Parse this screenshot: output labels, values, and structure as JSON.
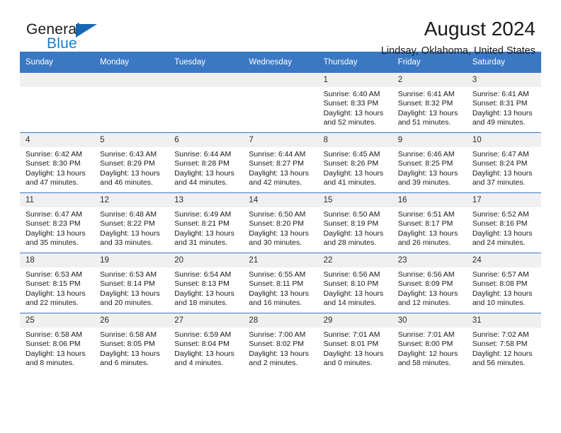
{
  "brand": {
    "name_top": "General",
    "name_bottom": "Blue",
    "accent_color": "#1a7ec8",
    "triangle_color": "#1567b2"
  },
  "header": {
    "month_title": "August 2024",
    "location": "Lindsay, Oklahoma, United States"
  },
  "calendar": {
    "header_color": "#3b78c3",
    "daynum_background": "#f0f0f0",
    "weekdays": [
      "Sunday",
      "Monday",
      "Tuesday",
      "Wednesday",
      "Thursday",
      "Friday",
      "Saturday"
    ],
    "weeks": [
      [
        {
          "day": "",
          "empty": true
        },
        {
          "day": "",
          "empty": true
        },
        {
          "day": "",
          "empty": true
        },
        {
          "day": "",
          "empty": true
        },
        {
          "day": "1",
          "sunrise": "Sunrise: 6:40 AM",
          "sunset": "Sunset: 8:33 PM",
          "daylight_line1": "Daylight: 13 hours",
          "daylight_line2": "and 52 minutes."
        },
        {
          "day": "2",
          "sunrise": "Sunrise: 6:41 AM",
          "sunset": "Sunset: 8:32 PM",
          "daylight_line1": "Daylight: 13 hours",
          "daylight_line2": "and 51 minutes."
        },
        {
          "day": "3",
          "sunrise": "Sunrise: 6:41 AM",
          "sunset": "Sunset: 8:31 PM",
          "daylight_line1": "Daylight: 13 hours",
          "daylight_line2": "and 49 minutes."
        }
      ],
      [
        {
          "day": "4",
          "sunrise": "Sunrise: 6:42 AM",
          "sunset": "Sunset: 8:30 PM",
          "daylight_line1": "Daylight: 13 hours",
          "daylight_line2": "and 47 minutes."
        },
        {
          "day": "5",
          "sunrise": "Sunrise: 6:43 AM",
          "sunset": "Sunset: 8:29 PM",
          "daylight_line1": "Daylight: 13 hours",
          "daylight_line2": "and 46 minutes."
        },
        {
          "day": "6",
          "sunrise": "Sunrise: 6:44 AM",
          "sunset": "Sunset: 8:28 PM",
          "daylight_line1": "Daylight: 13 hours",
          "daylight_line2": "and 44 minutes."
        },
        {
          "day": "7",
          "sunrise": "Sunrise: 6:44 AM",
          "sunset": "Sunset: 8:27 PM",
          "daylight_line1": "Daylight: 13 hours",
          "daylight_line2": "and 42 minutes."
        },
        {
          "day": "8",
          "sunrise": "Sunrise: 6:45 AM",
          "sunset": "Sunset: 8:26 PM",
          "daylight_line1": "Daylight: 13 hours",
          "daylight_line2": "and 41 minutes."
        },
        {
          "day": "9",
          "sunrise": "Sunrise: 6:46 AM",
          "sunset": "Sunset: 8:25 PM",
          "daylight_line1": "Daylight: 13 hours",
          "daylight_line2": "and 39 minutes."
        },
        {
          "day": "10",
          "sunrise": "Sunrise: 6:47 AM",
          "sunset": "Sunset: 8:24 PM",
          "daylight_line1": "Daylight: 13 hours",
          "daylight_line2": "and 37 minutes."
        }
      ],
      [
        {
          "day": "11",
          "sunrise": "Sunrise: 6:47 AM",
          "sunset": "Sunset: 8:23 PM",
          "daylight_line1": "Daylight: 13 hours",
          "daylight_line2": "and 35 minutes."
        },
        {
          "day": "12",
          "sunrise": "Sunrise: 6:48 AM",
          "sunset": "Sunset: 8:22 PM",
          "daylight_line1": "Daylight: 13 hours",
          "daylight_line2": "and 33 minutes."
        },
        {
          "day": "13",
          "sunrise": "Sunrise: 6:49 AM",
          "sunset": "Sunset: 8:21 PM",
          "daylight_line1": "Daylight: 13 hours",
          "daylight_line2": "and 31 minutes."
        },
        {
          "day": "14",
          "sunrise": "Sunrise: 6:50 AM",
          "sunset": "Sunset: 8:20 PM",
          "daylight_line1": "Daylight: 13 hours",
          "daylight_line2": "and 30 minutes."
        },
        {
          "day": "15",
          "sunrise": "Sunrise: 6:50 AM",
          "sunset": "Sunset: 8:19 PM",
          "daylight_line1": "Daylight: 13 hours",
          "daylight_line2": "and 28 minutes."
        },
        {
          "day": "16",
          "sunrise": "Sunrise: 6:51 AM",
          "sunset": "Sunset: 8:17 PM",
          "daylight_line1": "Daylight: 13 hours",
          "daylight_line2": "and 26 minutes."
        },
        {
          "day": "17",
          "sunrise": "Sunrise: 6:52 AM",
          "sunset": "Sunset: 8:16 PM",
          "daylight_line1": "Daylight: 13 hours",
          "daylight_line2": "and 24 minutes."
        }
      ],
      [
        {
          "day": "18",
          "sunrise": "Sunrise: 6:53 AM",
          "sunset": "Sunset: 8:15 PM",
          "daylight_line1": "Daylight: 13 hours",
          "daylight_line2": "and 22 minutes."
        },
        {
          "day": "19",
          "sunrise": "Sunrise: 6:53 AM",
          "sunset": "Sunset: 8:14 PM",
          "daylight_line1": "Daylight: 13 hours",
          "daylight_line2": "and 20 minutes."
        },
        {
          "day": "20",
          "sunrise": "Sunrise: 6:54 AM",
          "sunset": "Sunset: 8:13 PM",
          "daylight_line1": "Daylight: 13 hours",
          "daylight_line2": "and 18 minutes."
        },
        {
          "day": "21",
          "sunrise": "Sunrise: 6:55 AM",
          "sunset": "Sunset: 8:11 PM",
          "daylight_line1": "Daylight: 13 hours",
          "daylight_line2": "and 16 minutes."
        },
        {
          "day": "22",
          "sunrise": "Sunrise: 6:56 AM",
          "sunset": "Sunset: 8:10 PM",
          "daylight_line1": "Daylight: 13 hours",
          "daylight_line2": "and 14 minutes."
        },
        {
          "day": "23",
          "sunrise": "Sunrise: 6:56 AM",
          "sunset": "Sunset: 8:09 PM",
          "daylight_line1": "Daylight: 13 hours",
          "daylight_line2": "and 12 minutes."
        },
        {
          "day": "24",
          "sunrise": "Sunrise: 6:57 AM",
          "sunset": "Sunset: 8:08 PM",
          "daylight_line1": "Daylight: 13 hours",
          "daylight_line2": "and 10 minutes."
        }
      ],
      [
        {
          "day": "25",
          "sunrise": "Sunrise: 6:58 AM",
          "sunset": "Sunset: 8:06 PM",
          "daylight_line1": "Daylight: 13 hours",
          "daylight_line2": "and 8 minutes."
        },
        {
          "day": "26",
          "sunrise": "Sunrise: 6:58 AM",
          "sunset": "Sunset: 8:05 PM",
          "daylight_line1": "Daylight: 13 hours",
          "daylight_line2": "and 6 minutes."
        },
        {
          "day": "27",
          "sunrise": "Sunrise: 6:59 AM",
          "sunset": "Sunset: 8:04 PM",
          "daylight_line1": "Daylight: 13 hours",
          "daylight_line2": "and 4 minutes."
        },
        {
          "day": "28",
          "sunrise": "Sunrise: 7:00 AM",
          "sunset": "Sunset: 8:02 PM",
          "daylight_line1": "Daylight: 13 hours",
          "daylight_line2": "and 2 minutes."
        },
        {
          "day": "29",
          "sunrise": "Sunrise: 7:01 AM",
          "sunset": "Sunset: 8:01 PM",
          "daylight_line1": "Daylight: 13 hours",
          "daylight_line2": "and 0 minutes."
        },
        {
          "day": "30",
          "sunrise": "Sunrise: 7:01 AM",
          "sunset": "Sunset: 8:00 PM",
          "daylight_line1": "Daylight: 12 hours",
          "daylight_line2": "and 58 minutes."
        },
        {
          "day": "31",
          "sunrise": "Sunrise: 7:02 AM",
          "sunset": "Sunset: 7:58 PM",
          "daylight_line1": "Daylight: 12 hours",
          "daylight_line2": "and 56 minutes."
        }
      ]
    ]
  }
}
